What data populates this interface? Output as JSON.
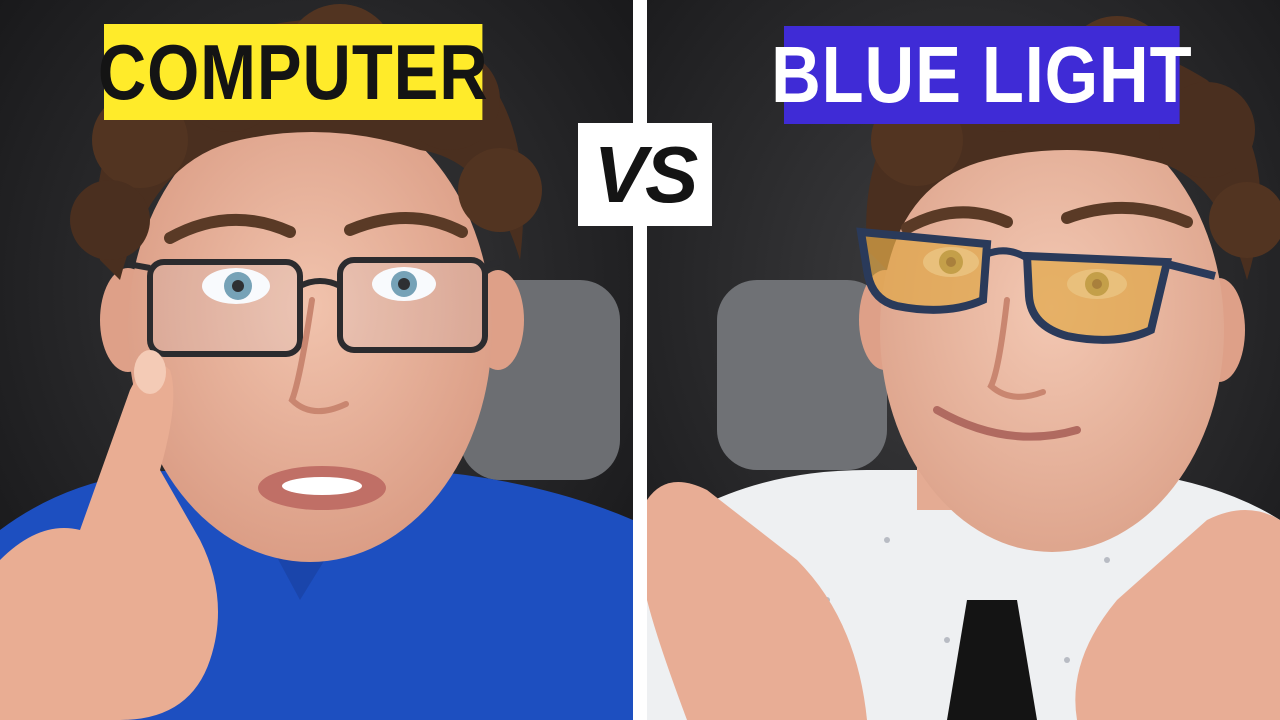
{
  "thumbnail": {
    "left_label": "COMPUTER",
    "right_label": "BLUE LIGHT",
    "vs_label": "VS"
  },
  "colors": {
    "left_label_bg": "#ffeb2a",
    "left_label_text": "#141414",
    "right_label_bg": "#3f2bd6",
    "right_label_text": "#ffffff",
    "divider": "#ffffff",
    "vs_bg": "#ffffff",
    "left_shirt": "#1d4fc0",
    "right_lens_tint": "#e0a84a"
  },
  "icons": {
    "left_photo": "person-with-clear-computer-glasses",
    "right_photo": "person-with-orange-blue-light-glasses"
  }
}
